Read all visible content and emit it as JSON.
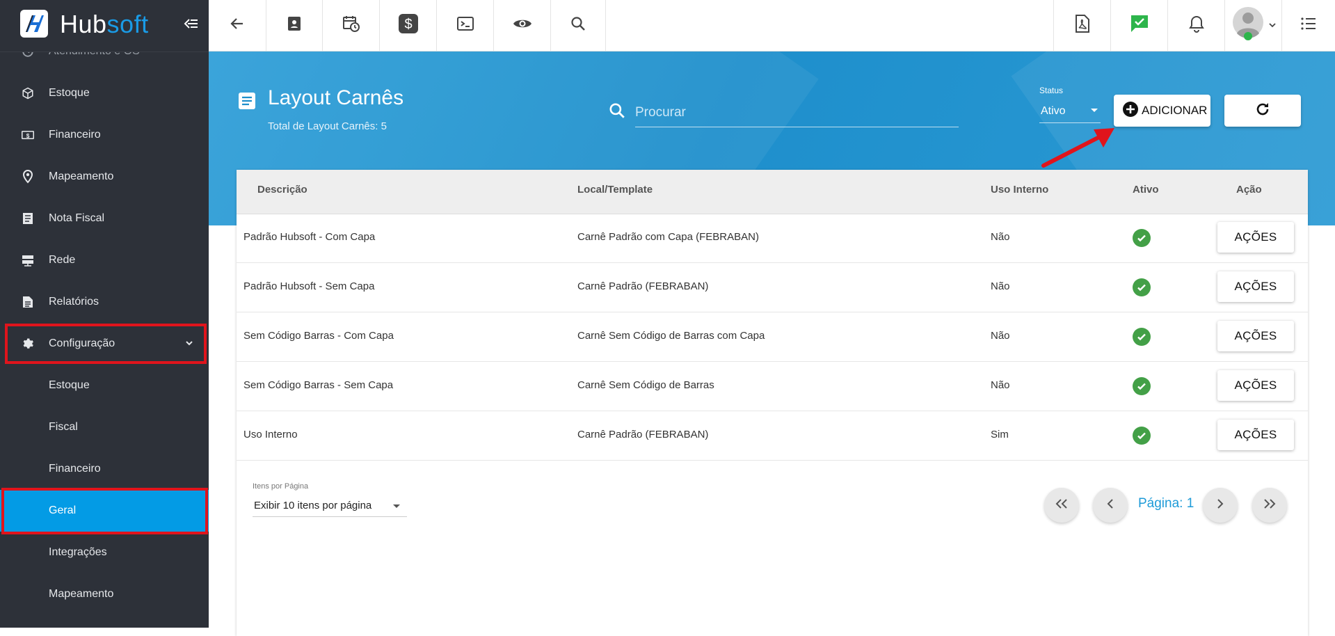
{
  "app": {
    "brand_primary": "Hub",
    "brand_secondary": "soft",
    "accent_color": "#039be5",
    "sidebar_color": "#2d3139",
    "highlight_color": "#e0141c"
  },
  "sidebar": {
    "items": [
      {
        "label": "Atendimento e OS",
        "icon": "clock-icon"
      },
      {
        "label": "Estoque",
        "icon": "box-icon"
      },
      {
        "label": "Financeiro",
        "icon": "money-icon"
      },
      {
        "label": "Mapeamento",
        "icon": "map-pin-icon"
      },
      {
        "label": "Nota Fiscal",
        "icon": "document-icon"
      },
      {
        "label": "Rede",
        "icon": "server-icon"
      },
      {
        "label": "Relatórios",
        "icon": "report-icon"
      },
      {
        "label": "Configuração",
        "icon": "gear-icon"
      }
    ],
    "subitems": [
      {
        "label": "Estoque"
      },
      {
        "label": "Fiscal"
      },
      {
        "label": "Financeiro"
      },
      {
        "label": "Geral"
      },
      {
        "label": "Integrações"
      },
      {
        "label": "Mapeamento"
      }
    ]
  },
  "topbar": {
    "left_icons": [
      "back-arrow-icon",
      "contact-card-icon",
      "calendar-clock-icon",
      "dollar-icon",
      "terminal-icon",
      "eye-icon",
      "search-icon"
    ],
    "right_icons": [
      "pdf-icon",
      "chat-check-icon",
      "bell-icon",
      "avatar",
      "list-icon"
    ]
  },
  "header": {
    "title": "Layout Carnês",
    "subtitle": "Total de Layout Carnês: 5",
    "search_placeholder": "Procurar",
    "status_label": "Status",
    "status_value": "Ativo",
    "add_label": "ADICIONAR"
  },
  "table": {
    "columns": [
      "Descrição",
      "Local/Template",
      "Uso Interno",
      "Ativo",
      "Ação"
    ],
    "rows": [
      {
        "descricao": "Padrão Hubsoft - Com Capa",
        "template": "Carnê Padrão com Capa (FEBRABAN)",
        "uso_interno": "Não",
        "ativo": true,
        "acao": "AÇÕES"
      },
      {
        "descricao": "Padrão Hubsoft - Sem Capa",
        "template": "Carnê Padrão (FEBRABAN)",
        "uso_interno": "Não",
        "ativo": true,
        "acao": "AÇÕES"
      },
      {
        "descricao": "Sem Código Barras - Com Capa",
        "template": "Carnê Sem Código de Barras com Capa",
        "uso_interno": "Não",
        "ativo": true,
        "acao": "AÇÕES"
      },
      {
        "descricao": "Sem Código Barras - Sem Capa",
        "template": "Carnê Sem Código de Barras",
        "uso_interno": "Não",
        "ativo": true,
        "acao": "AÇÕES"
      },
      {
        "descricao": "Uso Interno",
        "template": "Carnê Padrão (FEBRABAN)",
        "uso_interno": "Sim",
        "ativo": true,
        "acao": "AÇÕES"
      }
    ]
  },
  "pagination": {
    "items_per_page_label": "Itens por Página",
    "items_per_page_value": "Exibir 10 itens por página",
    "page_label": "Página: 1"
  }
}
